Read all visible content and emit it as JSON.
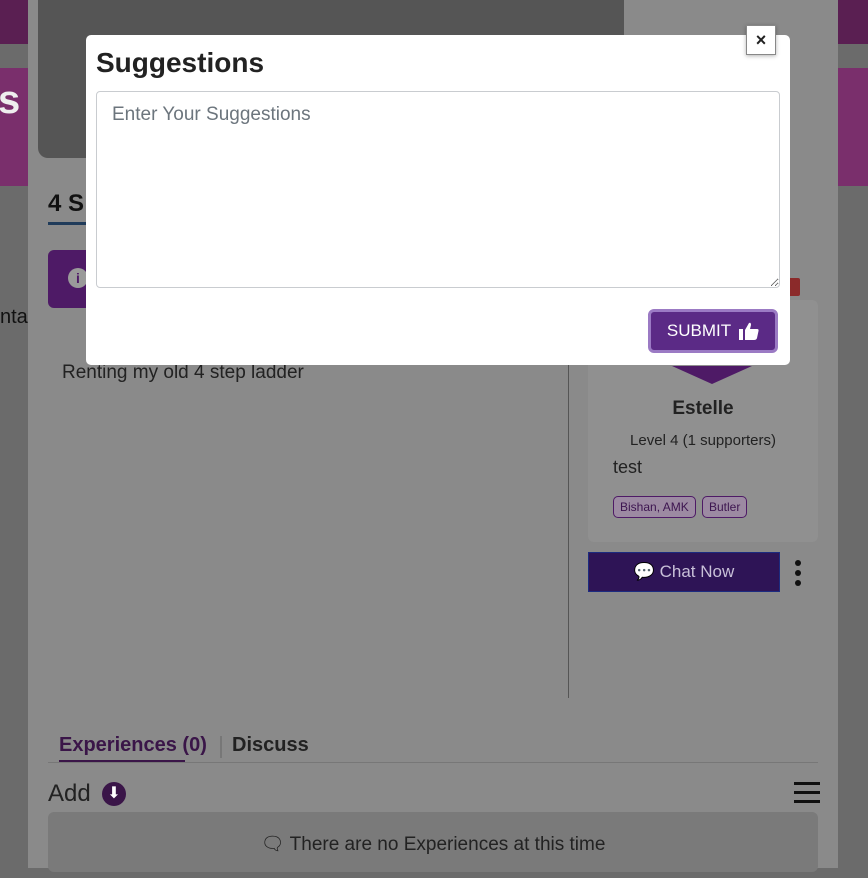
{
  "background": {
    "hero_title_fragment": "s",
    "listing_title_fragment": "4 S",
    "left_edge_text": "nta",
    "info_icon": "info-icon",
    "description": "Renting my old 4 step ladder",
    "profile": {
      "name": "Estelle",
      "level": "Level 4 (1 supporters)",
      "bio": "test",
      "tags": [
        "Bishan, AMK",
        "Butler"
      ]
    },
    "chat_button_label": "Chat Now",
    "tabs": {
      "experiences": "Experiences (0)",
      "discuss": "Discuss"
    },
    "add_label": "Add",
    "empty_message": "There are no Experiences at this time"
  },
  "modal": {
    "title": "Suggestions",
    "close_symbol": "×",
    "textarea_placeholder": "Enter Your Suggestions",
    "textarea_value": "",
    "submit_label": "SUBMIT",
    "submit_icon": "thumbs-up-icon"
  },
  "colors": {
    "brand_purple": "#5b2a86",
    "submit_border": "#9b7ac4",
    "overlay": "#6b6b6b"
  }
}
